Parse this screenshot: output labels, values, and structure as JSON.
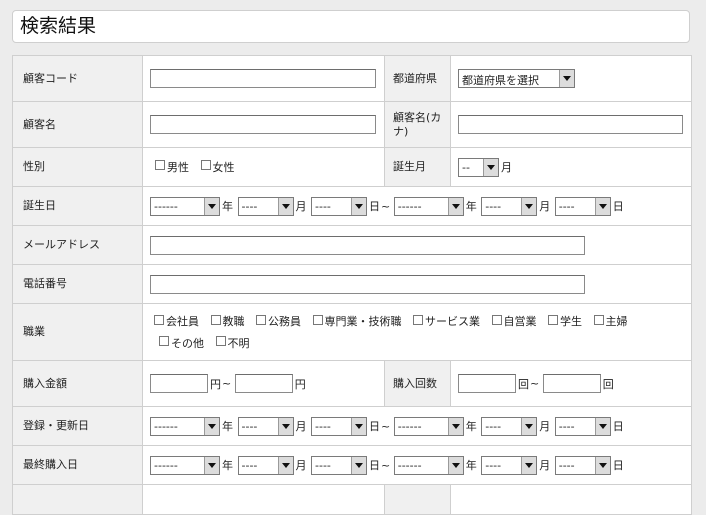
{
  "page": {
    "title": "検索結果"
  },
  "fields": {
    "customer_code": {
      "label": "顧客コード"
    },
    "prefecture": {
      "label": "都道府県",
      "select": "都道府県を選択"
    },
    "customer_name": {
      "label": "顧客名"
    },
    "customer_kana": {
      "label": "顧客名(カナ)"
    },
    "gender": {
      "label": "性別",
      "options": [
        "男性",
        "女性"
      ]
    },
    "birth_month": {
      "label": "誕生月",
      "select": "--",
      "unit": "月"
    },
    "birthday": {
      "label": "誕生日"
    },
    "email": {
      "label": "メールアドレス"
    },
    "phone": {
      "label": "電話番号"
    },
    "occupation": {
      "label": "職業",
      "options": [
        "会社員",
        "教職",
        "公務員",
        "専門業・技術職",
        "サービス業",
        "自営業",
        "学生",
        "主婦",
        "その他",
        "不明"
      ]
    },
    "purchase_amount": {
      "label": "購入金額",
      "unit": "円",
      "tilde": "~"
    },
    "purchase_count": {
      "label": "購入回数",
      "unit": "回",
      "tilde": "~"
    },
    "updated_date": {
      "label": "登録・更新日"
    },
    "last_purchase": {
      "label": "最終購入日"
    }
  },
  "date_range": {
    "year_placeholder": "------",
    "short_placeholder": "----",
    "year_unit": "年",
    "month_unit": "月",
    "day_unit": "日",
    "tilde": "~"
  }
}
